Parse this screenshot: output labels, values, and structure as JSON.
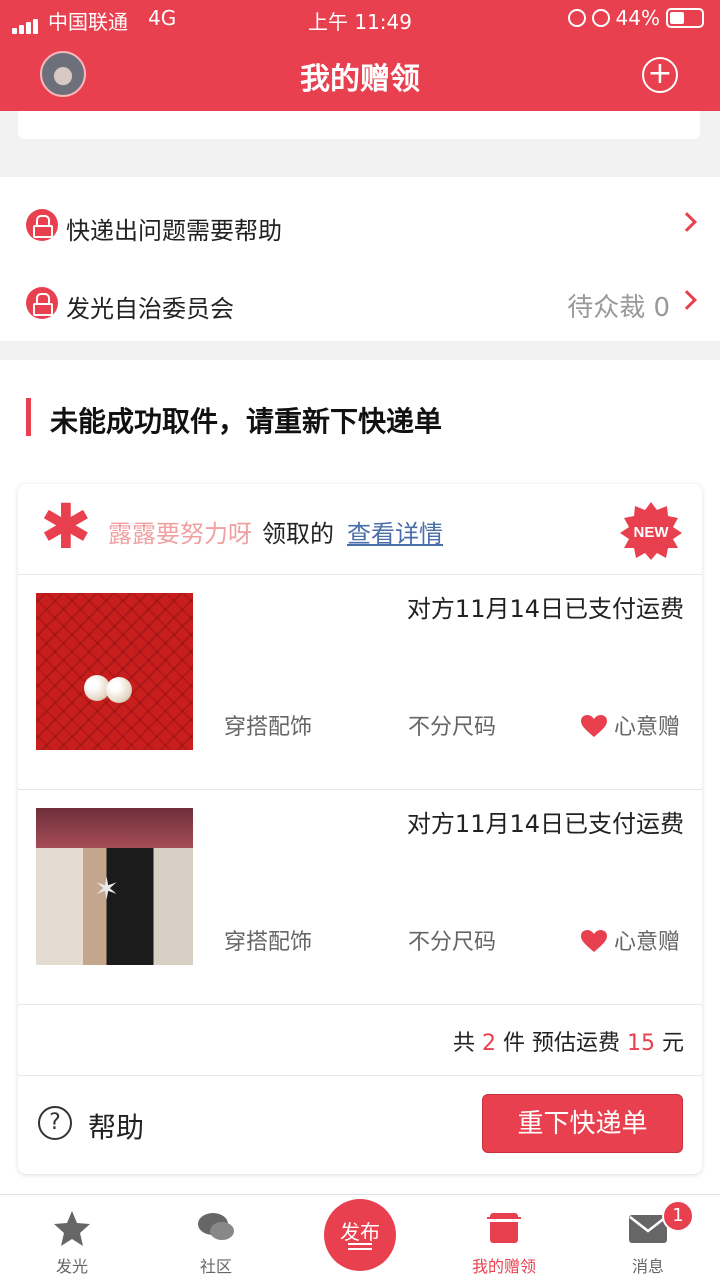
{
  "status_bar": {
    "carrier": "中国联通",
    "network": "4G",
    "time": "上午 11:49",
    "battery": "44%"
  },
  "header": {
    "title": "我的赠领",
    "add_icon": "plus-circle-icon"
  },
  "menu": {
    "items": [
      {
        "label": "快递出问题需要帮助",
        "extra": ""
      },
      {
        "label": "发光自治委员会",
        "extra": "待众裁 0"
      }
    ]
  },
  "section": {
    "title": "未能成功取件，请重新下快递单"
  },
  "order": {
    "giver": "露露要努力呀",
    "claimed_text": "领取的",
    "detail_link": "查看详情",
    "badge": "NEW",
    "items": [
      {
        "paid_status": "对方11月14日已支付运费",
        "category": "穿搭配饰",
        "size": "不分尺码",
        "gift_type": "心意赠"
      },
      {
        "paid_status": "对方11月14日已支付运费",
        "category": "穿搭配饰",
        "size": "不分尺码",
        "gift_type": "心意赠"
      }
    ],
    "summary": {
      "prefix": "共",
      "count": "2",
      "unit": "件",
      "shipping_label": "预估运费",
      "shipping_fee": "15",
      "currency": "元"
    },
    "help_label": "帮助",
    "reorder_button": "重下快递单"
  },
  "tabbar": {
    "tabs": [
      {
        "label": "发光"
      },
      {
        "label": "社区"
      },
      {
        "label": "发布"
      },
      {
        "label": "我的赠领"
      },
      {
        "label": "消息"
      }
    ],
    "message_badge": "1"
  },
  "colors": {
    "accent": "#e8404f",
    "link": "#4a6ea8",
    "giver_name": "#f0a0a0"
  }
}
